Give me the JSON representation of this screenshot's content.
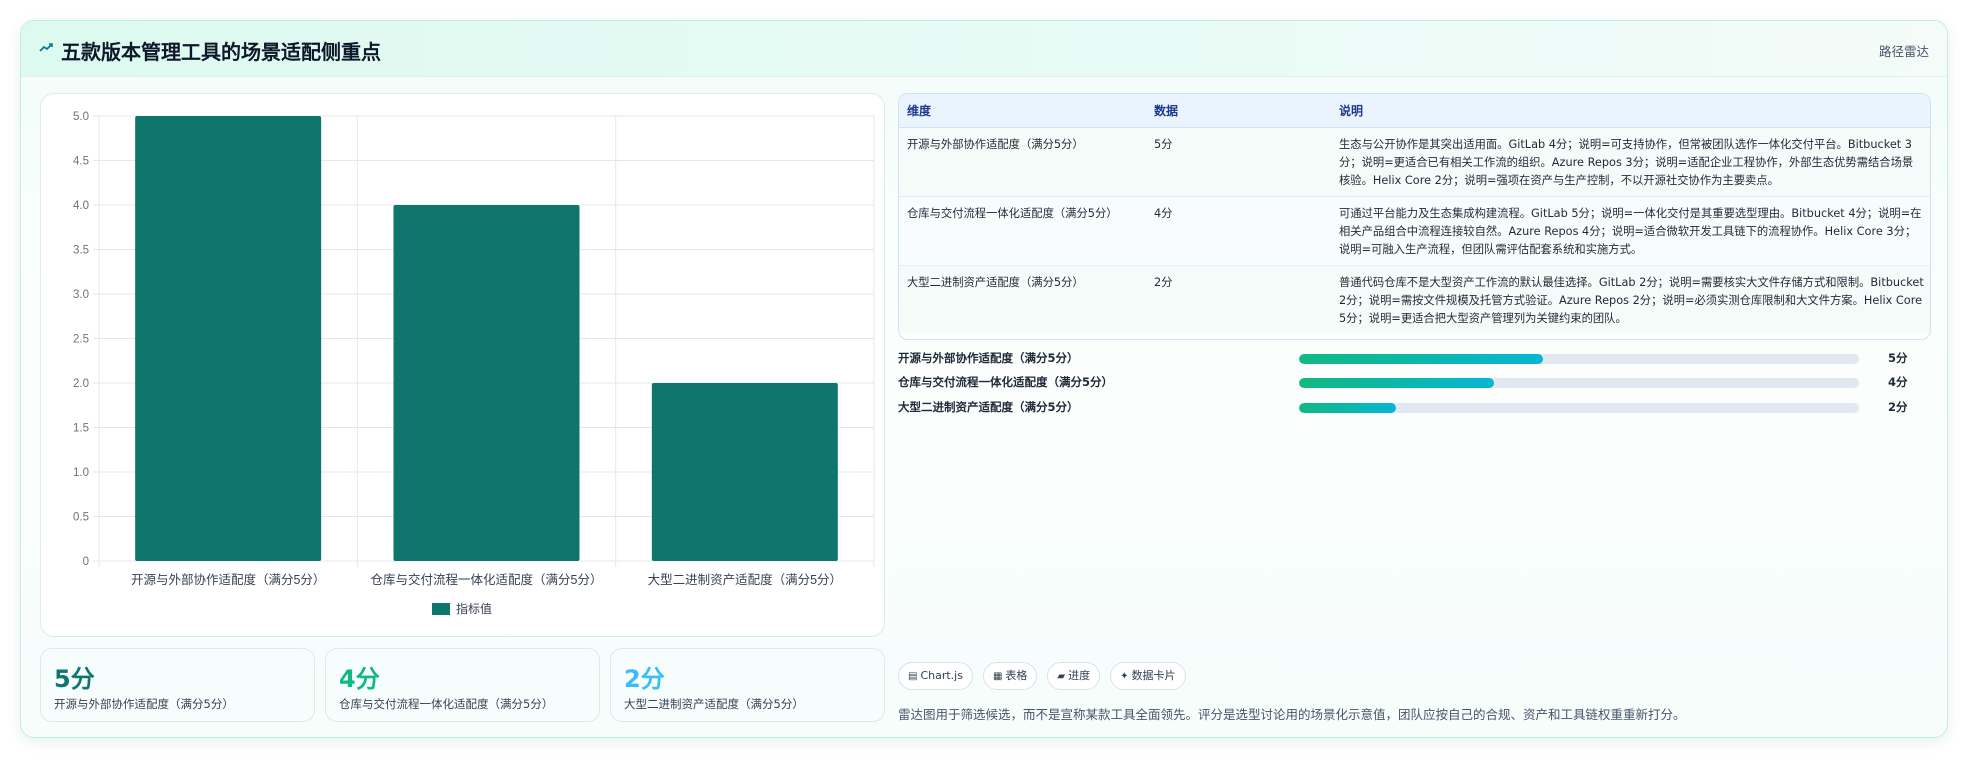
{
  "header": {
    "title": "五款版本管理工具的场景适配侧重点",
    "link": "路径雷达",
    "icon": "trend-icon"
  },
  "chart_data": {
    "type": "bar",
    "categories": [
      "开源与外部协作适配度（满分5分）",
      "仓库与交付流程一体化适配度（满分5分）",
      "大型二进制资产适配度（满分5分）"
    ],
    "series": [
      {
        "name": "指标值",
        "values": [
          5,
          4,
          2
        ],
        "color": "#0f766e"
      }
    ],
    "yticks": [
      "0",
      "0.5",
      "1.0",
      "1.5",
      "2.0",
      "2.5",
      "3.0",
      "3.5",
      "4.0",
      "4.5",
      "5.0"
    ],
    "ylim": [
      0,
      5
    ],
    "grid": true,
    "legend": "bottom"
  },
  "table": {
    "headers": [
      "维度",
      "数据",
      "说明"
    ],
    "rows": [
      {
        "dim": "开源与外部协作适配度（满分5分）",
        "data": "5分",
        "desc": "生态与公开协作是其突出适用面。GitLab 4分；说明=可支持协作，但常被团队选作一体化交付平台。Bitbucket 3分；说明=更适合已有相关工作流的组织。Azure Repos 3分；说明=适配企业工程协作，外部生态优势需结合场景核验。Helix Core 2分；说明=强项在资产与生产控制，不以开源社交协作为主要卖点。"
      },
      {
        "dim": "仓库与交付流程一体化适配度（满分5分）",
        "data": "4分",
        "desc": "可通过平台能力及生态集成构建流程。GitLab 5分；说明=一体化交付是其重要选型理由。Bitbucket 4分；说明=在相关产品组合中流程连接较自然。Azure Repos 4分；说明=适合微软开发工具链下的流程协作。Helix Core 3分；说明=可融入生产流程，但团队需评估配套系统和实施方式。"
      },
      {
        "dim": "大型二进制资产适配度（满分5分）",
        "data": "2分",
        "desc": "普通代码仓库不是大型资产工作流的默认最佳选择。GitLab 2分；说明=需要核实大文件存储方式和限制。Bitbucket 2分；说明=需按文件规模及托管方式验证。Azure Repos 2分；说明=必须实测仓库限制和大文件方案。Helix Core 5分；说明=更适合把大型资产管理列为关键约束的团队。"
      }
    ]
  },
  "progress": [
    {
      "label": "开源与外部协作适配度（满分5分）",
      "value": 5,
      "max": 5,
      "fraction": 0.435,
      "display": "5分"
    },
    {
      "label": "仓库与交付流程一体化适配度（满分5分）",
      "value": 4,
      "max": 5,
      "fraction": 0.348,
      "display": "4分"
    },
    {
      "label": "大型二进制资产适配度（满分5分）",
      "value": 2,
      "max": 5,
      "fraction": 0.174,
      "display": "2分"
    }
  ],
  "stats": [
    {
      "value": "5分",
      "label": "开源与外部协作适配度（满分5分）",
      "color": "#0f766e"
    },
    {
      "value": "4分",
      "label": "仓库与交付流程一体化适配度（满分5分）",
      "color": "#10b981"
    },
    {
      "value": "2分",
      "label": "大型二进制资产适配度（满分5分）",
      "color": "#38bdf8"
    }
  ],
  "chips": [
    {
      "icon": "▤",
      "label": "Chart.js",
      "icon_name": "chart-icon"
    },
    {
      "icon": "▦",
      "label": "表格",
      "icon_name": "table-icon"
    },
    {
      "icon": "▰",
      "label": "进度",
      "icon_name": "progress-icon"
    },
    {
      "icon": "✦",
      "label": "数据卡片",
      "icon_name": "sparkle-icon"
    }
  ],
  "footnote": "雷达图用于筛选候选，而不是宣称某款工具全面领先。评分是选型讨论用的场景化示意值，团队应按自己的合规、资产和工具链权重重新打分。"
}
